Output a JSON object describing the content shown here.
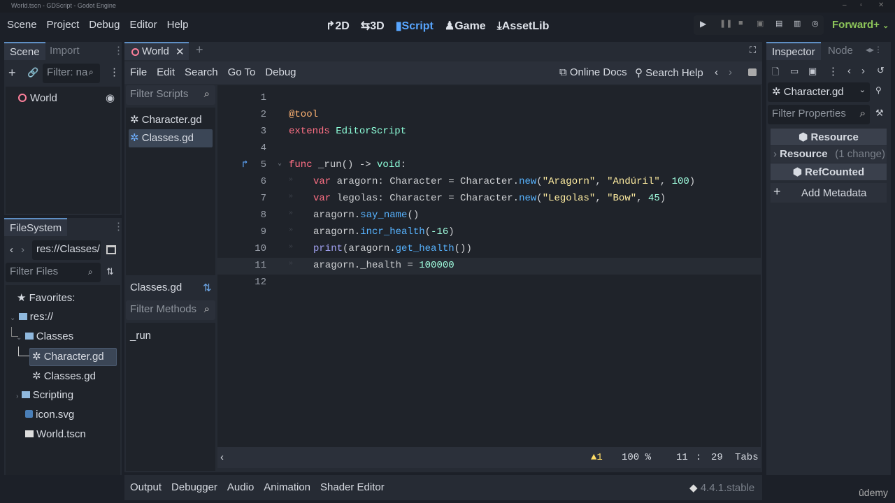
{
  "window": {
    "title": "World.tscn - GDScript - Godot Engine",
    "controls": [
      "–",
      "▫",
      "✕"
    ]
  },
  "menu": [
    "Scene",
    "Project",
    "Debug",
    "Editor",
    "Help"
  ],
  "workspaces": [
    {
      "label": "2D",
      "icon": "↱"
    },
    {
      "label": "3D",
      "icon": "⇆"
    },
    {
      "label": "Script",
      "icon": "▮"
    },
    {
      "label": "Game",
      "icon": "♟"
    },
    {
      "label": "AssetLib",
      "icon": "⤓"
    }
  ],
  "renderer": "Forward+",
  "scene_dock": {
    "tabs": [
      "Scene",
      "Import"
    ],
    "filter_placeholder": "Filter: na",
    "root": "World"
  },
  "filesystem": {
    "tab": "FileSystem",
    "path": "res://Classes/",
    "filter_placeholder": "Filter Files",
    "items": [
      {
        "label": "Favorites:",
        "icon": "★"
      },
      {
        "label": "res://",
        "icon": "folder"
      },
      {
        "label": "Classes",
        "icon": "folder"
      },
      {
        "label": "Character.gd",
        "icon": "gear",
        "selected": true
      },
      {
        "label": "Classes.gd",
        "icon": "gear"
      },
      {
        "label": "Scripting",
        "icon": "folder"
      },
      {
        "label": "icon.svg",
        "icon": "image"
      },
      {
        "label": "World.tscn",
        "icon": "clapper"
      }
    ]
  },
  "scene_tab": "World",
  "script_menu": [
    "File",
    "Edit",
    "Search",
    "Go To",
    "Debug"
  ],
  "script_tools": {
    "online_docs": "Online Docs",
    "search_help": "Search Help"
  },
  "scripts": {
    "filter_placeholder": "Filter Scripts",
    "items": [
      "Character.gd",
      "Classes.gd"
    ],
    "current": "Classes.gd",
    "methods_filter": "Filter Methods",
    "methods": [
      "_run"
    ]
  },
  "code": [
    [],
    [
      [
        "@tool",
        "an"
      ]
    ],
    [
      [
        "extends",
        "kw"
      ],
      [
        " ",
        "tx"
      ],
      [
        "EditorScript",
        "ty"
      ]
    ],
    [],
    [
      [
        "func",
        "kw"
      ],
      [
        " _run() -> ",
        "tx"
      ],
      [
        "void",
        "ty"
      ],
      [
        ":",
        "tx"
      ]
    ],
    [
      [
        "var",
        "kw"
      ],
      [
        " aragorn: Character = Character.",
        "tx"
      ],
      [
        "new",
        "fn"
      ],
      [
        "(",
        "tx"
      ],
      [
        "\"Aragorn\"",
        "st"
      ],
      [
        ", ",
        "tx"
      ],
      [
        "\"Andúril\"",
        "st"
      ],
      [
        ", ",
        "tx"
      ],
      [
        "100",
        "nu"
      ],
      [
        ")",
        "tx"
      ]
    ],
    [
      [
        "var",
        "kw"
      ],
      [
        " legolas: Character = Character.",
        "tx"
      ],
      [
        "new",
        "fn"
      ],
      [
        "(",
        "tx"
      ],
      [
        "\"Legolas\"",
        "st"
      ],
      [
        ", ",
        "tx"
      ],
      [
        "\"Bow\"",
        "st"
      ],
      [
        ", ",
        "tx"
      ],
      [
        "45",
        "nu"
      ],
      [
        ")",
        "tx"
      ]
    ],
    [
      [
        "aragorn.",
        "tx"
      ],
      [
        "say_name",
        "fn"
      ],
      [
        "()",
        "tx"
      ]
    ],
    [
      [
        "aragorn.",
        "tx"
      ],
      [
        "incr_health",
        "fn"
      ],
      [
        "(",
        "tx"
      ],
      [
        "-16",
        "nu"
      ],
      [
        ")",
        "tx"
      ]
    ],
    [
      [
        "print",
        "bi"
      ],
      [
        "(aragorn.",
        "tx"
      ],
      [
        "get_health",
        "fn"
      ],
      [
        "())",
        "tx"
      ]
    ],
    [
      [
        "aragorn._health = ",
        "tx"
      ],
      [
        "100000",
        "nu"
      ]
    ],
    []
  ],
  "status": {
    "warnings": "1",
    "zoom": "100 %",
    "line": "11",
    "sep": ":",
    "col": "29",
    "indent": "Tabs"
  },
  "bottom": {
    "tabs": [
      "Output",
      "Debugger",
      "Audio",
      "Animation",
      "Shader Editor"
    ],
    "version": "4.4.1.stable"
  },
  "inspector": {
    "tabs": [
      "Inspector",
      "Node"
    ],
    "resource": "Character.gd",
    "filter_placeholder": "Filter Properties",
    "sections": [
      "Resource",
      "RefCounted"
    ],
    "prop": "Resource",
    "prop_note": "(1 change)",
    "add_metadata": "Add Metadata"
  },
  "watermark": "ûdemy"
}
